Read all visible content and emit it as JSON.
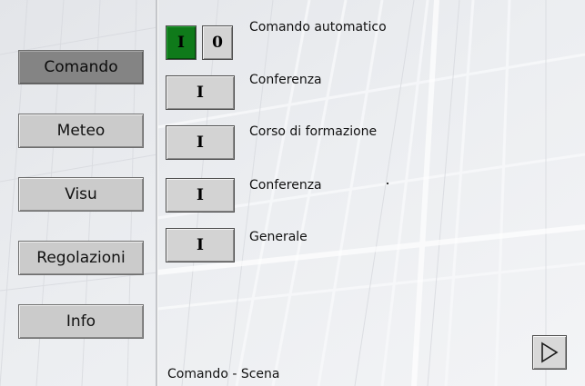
{
  "nav": {
    "items": [
      {
        "label": "Comando",
        "active": true
      },
      {
        "label": "Meteo",
        "active": false
      },
      {
        "label": "Visu",
        "active": false
      },
      {
        "label": "Regolazioni",
        "active": false
      },
      {
        "label": "Info",
        "active": false
      }
    ]
  },
  "scenes": [
    {
      "label": "Comando automatico",
      "on_label": "I",
      "off_label": "0",
      "state": "on"
    },
    {
      "label": "Conferenza",
      "button_label": "I"
    },
    {
      "label": "Corso di formazione",
      "button_label": "I"
    },
    {
      "label": "Conferenza",
      "button_label": "I"
    },
    {
      "label": "Generale",
      "button_label": "I"
    }
  ],
  "footer": {
    "title": "Comando - Scena",
    "next_icon": "play-triangle-icon"
  },
  "colors": {
    "active_green": "#0f7a1a",
    "nav_active": "#848484",
    "button_face": "#d3d3d3"
  }
}
